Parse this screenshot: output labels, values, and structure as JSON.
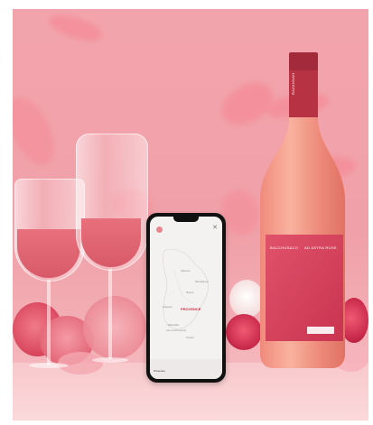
{
  "photo": {
    "background_color": "#f2a4ac",
    "wine_color": "#e8707c",
    "bottle_label_color": "#d2485e"
  },
  "bottle": {
    "neck_label": "RAZANNAH",
    "label_left": "BACCHUS&CO",
    "label_right": "AD ASTRA ROSE"
  },
  "phone": {
    "map_highlight": "PROVENCE",
    "map_labels": [
      "Valence",
      "Montelimar",
      "Nyons",
      "Avignon",
      "Marseille",
      "Aix-en-Provence",
      "Toulon"
    ],
    "footer_title": "Provence"
  }
}
